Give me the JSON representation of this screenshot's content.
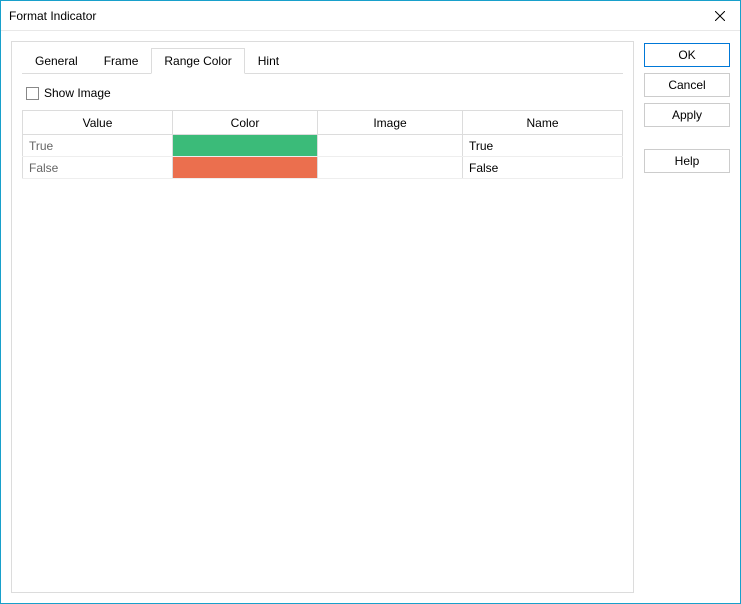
{
  "window": {
    "title": "Format Indicator"
  },
  "tabs": {
    "general": "General",
    "frame": "Frame",
    "range_color": "Range Color",
    "hint": "Hint"
  },
  "checkbox": {
    "show_image": "Show Image"
  },
  "table": {
    "headers": {
      "value": "Value",
      "color": "Color",
      "image": "Image",
      "name": "Name"
    },
    "rows": [
      {
        "value": "True",
        "color": "#3bbb79",
        "image": "",
        "name": "True"
      },
      {
        "value": "False",
        "color": "#eb6f4e",
        "image": "",
        "name": "False"
      }
    ]
  },
  "buttons": {
    "ok": "OK",
    "cancel": "Cancel",
    "apply": "Apply",
    "help": "Help"
  }
}
